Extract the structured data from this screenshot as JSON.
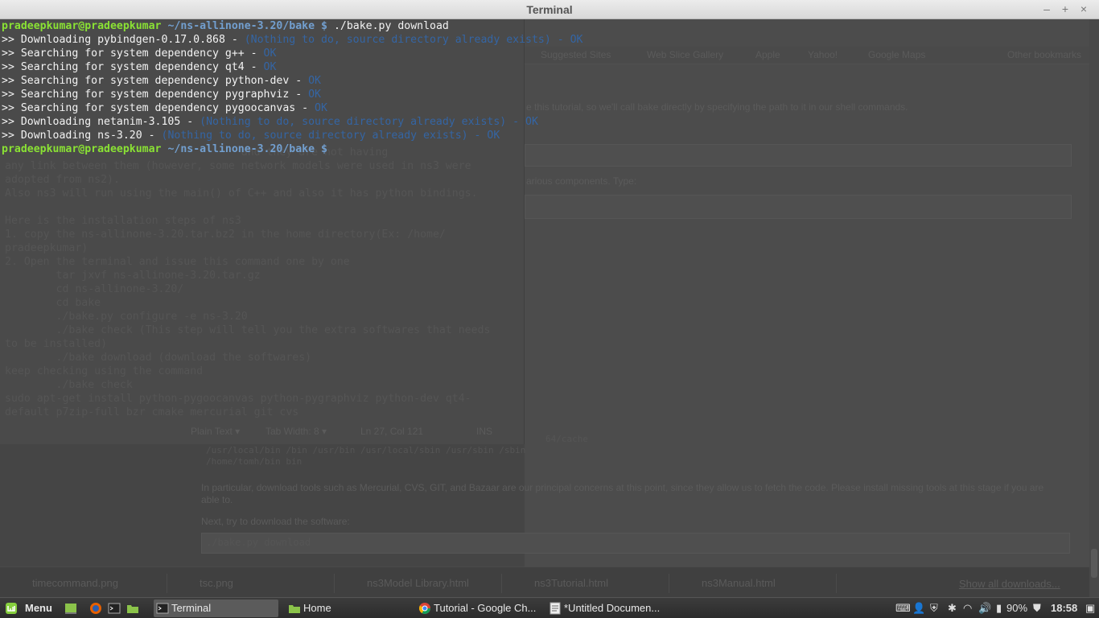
{
  "window": {
    "title": "Terminal",
    "controls": {
      "minimize": "–",
      "maximize": "+",
      "close": "×"
    }
  },
  "terminal": {
    "prompt_user": "pradeepkumar@pradeepkumar",
    "prompt_path": "~/ns-allinone-3.20/bake",
    "prompt_symbol": "$",
    "command": "./bake.py download",
    "lines": [
      {
        "text": ">> Downloading pybindgen-0.17.0.868 - ",
        "status": "(Nothing to do, source directory already exists) - OK"
      },
      {
        "text": ">> Searching for system dependency g++ - ",
        "status": "OK"
      },
      {
        "text": ">> Searching for system dependency qt4 - ",
        "status": "OK"
      },
      {
        "text": ">> Searching for system dependency python-dev - ",
        "status": "OK"
      },
      {
        "text": ">> Searching for system dependency pygraphviz - ",
        "status": "OK"
      },
      {
        "text": ">> Searching for system dependency pygoocanvas - ",
        "status": "OK"
      },
      {
        "text": ">> Downloading netanim-3.105 - ",
        "status": "(Nothing to do, source directory already exists) - OK"
      },
      {
        "text": ">> Downloading ns-3.20 - ",
        "status": "(Nothing to do, source directory already exists) - OK"
      }
    ],
    "final_prompt_user": "pradeepkumar@pradeepkumar",
    "final_prompt_path": "~/ns-allinone-3.20/bake",
    "final_prompt_symbol": "$"
  },
  "background": {
    "editor_lines": [
      "                                     and they are not having",
      "any link between them (however, some network models were used in ns3 were",
      "adopted from ns2).",
      "Also ns3 will run using the main() of C++ and also it has python bindings.",
      "",
      "Here is the installation steps of ns3",
      "1. copy the ns-allinone-3.20.tar.bz2 in the home directory(Ex: /home/",
      "pradeepkumar)",
      "2. Open the terminal and issue this command one by one",
      "        tar jxvf ns-allinone-3.20.tar.gz",
      "        cd ns-allinone-3.20/",
      "        cd bake",
      "        ./bake.py configure -e ns-3.20",
      "        ./bake check (This step will tell you the extra softwares that needs",
      "to be installed)",
      "        ./bake download (download the softwares)",
      "keep checking using the command",
      "        ./bake check",
      "sudo apt-get install python-pygoocanvas python-pygraphviz python-dev qt4-",
      "default p7zip-full bzr cmake mercurial git cvs"
    ],
    "editor_status": [
      "Plain Text ▾",
      "Tab Width: 8 ▾",
      "Ln 27, Col 121",
      "INS"
    ],
    "bookmarks": [
      "Suggested Sites",
      "Web Slice Gallery",
      "Apple",
      "Yahoo!",
      "Google Maps",
      "Other bookmarks"
    ],
    "browser_line_1": "e this tutorial, so we'll call bake directly by specifying the path to it in our shell commands.",
    "browser_line_2": "arious components. Type:",
    "path_lines": [
      "64/cache",
      "/usr/local/bin /bin /usr/bin /usr/local/sbin /usr/sbin /sbin",
      "/home/tomh/bin bin"
    ],
    "paragraph": "In particular, download tools such as Mercurial, CVS, GIT, and Bazaar are our principal concerns at this point, since they allow us to fetch the code. Please install missing tools at this stage if you are",
    "paragraph_2": "able to.",
    "next_text": "Next, try to download the software:",
    "code_text": "./bake.py download",
    "downloads": [
      "timecommand.png",
      "tsc.png",
      "ns3Model Library.html",
      "ns3Tutorial.html",
      "ns3Manual.html"
    ],
    "show_all_downloads": "Show all downloads..."
  },
  "taskbar": {
    "menu_label": "Menu",
    "windows": [
      "Terminal",
      "Home",
      "Tutorial - Google Ch...",
      "*Untitled Documen..."
    ],
    "battery": "90%",
    "clock": "18:58"
  },
  "colors": {
    "prompt_user": "#8ae234",
    "prompt_path": "#729fcf",
    "status_blue": "#3465a4",
    "text": "#f3f3f3"
  }
}
